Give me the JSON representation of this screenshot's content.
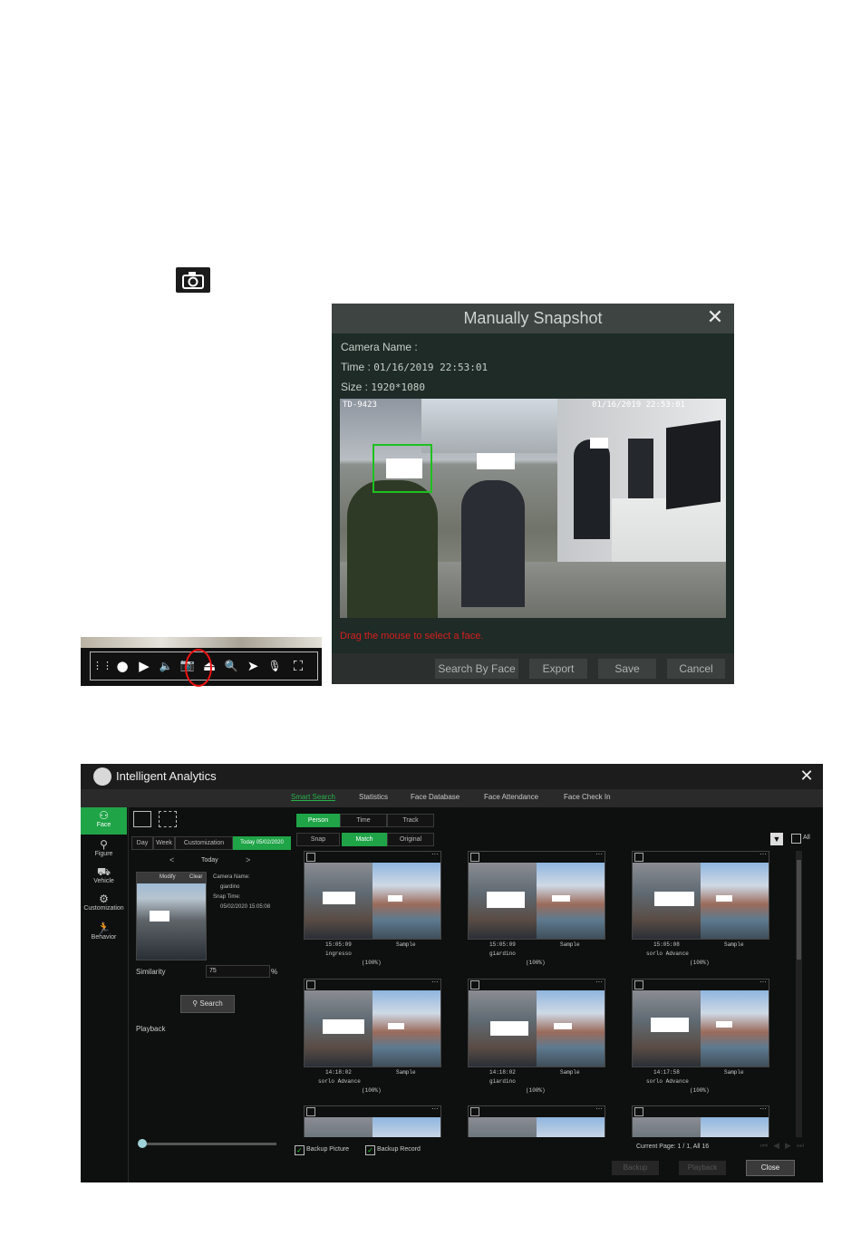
{
  "snapshot_icon": "camera-icon",
  "toolbar": {
    "icons": [
      "drag-handle-icon",
      "record-icon",
      "play-icon",
      "mute-icon",
      "snapshot-camera-icon",
      "pan-icon",
      "zoom-icon",
      "ptz-icon",
      "talk-icon",
      "face-frame-icon"
    ],
    "glyphs": [
      "⋮⋮",
      "●",
      "▶",
      "🔈",
      "📷",
      "⏏",
      "🔍",
      "➤",
      "🎙",
      "⛶"
    ]
  },
  "snapshot_dialog": {
    "title": "Manually Snapshot",
    "camera_name_label": "Camera Name :",
    "time_label": "Time :",
    "time_value": "01/16/2019 22:53:01",
    "size_label": "Size :",
    "size_value": "1920*1080",
    "osd_left": "TD-9423",
    "osd_right": "01/16/2019 22:53:01",
    "hint": "Drag the mouse to select a face.",
    "buttons": [
      "Search By Face",
      "Export",
      "Save",
      "Cancel"
    ]
  },
  "analytics": {
    "title": "Intelligent Analytics",
    "tabs": [
      "Smart Search",
      "Statistics",
      "Face Database",
      "Face Attendance",
      "Face Check In"
    ],
    "active_tab": "Smart Search",
    "sidebar": [
      {
        "label": "Face",
        "icon": "face-icon"
      },
      {
        "label": "Figure",
        "icon": "figure-icon"
      },
      {
        "label": "Vehicle",
        "icon": "vehicle-icon"
      },
      {
        "label": "Customization",
        "icon": "customization-icon"
      },
      {
        "label": "Behavior",
        "icon": "behavior-icon"
      }
    ],
    "period_tabs": [
      "Day",
      "Week",
      "Customization",
      "Today 05/02/2020"
    ],
    "date_nav": "Today",
    "face_panel": {
      "modify": "Modify",
      "clear": "Clear",
      "camera_name_label": "Camera Name:",
      "camera_name": "giardino",
      "snap_time_label": "Snap Time:",
      "snap_time": "05/02/2020 15:05:08"
    },
    "similarity_label": "Similarity",
    "similarity_value": "75",
    "similarity_unit": "%",
    "search_button": "Search",
    "playback_label": "Playback",
    "mode_tabs": [
      "Person",
      "Time",
      "Track"
    ],
    "view_tabs": [
      "Snap",
      "Match",
      "Original"
    ],
    "all_label": "All",
    "results": [
      {
        "time": "15:05:09",
        "camera": "ingresso",
        "sample": "Sample",
        "score": "(100%)"
      },
      {
        "time": "15:05:09",
        "camera": "giardino",
        "sample": "Sample",
        "score": "(100%)"
      },
      {
        "time": "15:05:08",
        "camera": "sorlo Advance",
        "sample": "Sample",
        "score": "(100%)"
      },
      {
        "time": "14:18:02",
        "camera": "sorlo Advance",
        "sample": "Sample",
        "score": "(100%)"
      },
      {
        "time": "14:18:02",
        "camera": "giardino",
        "sample": "Sample",
        "score": "(100%)"
      },
      {
        "time": "14:17:58",
        "camera": "sorlo Advance",
        "sample": "Sample",
        "score": "(100%)"
      }
    ],
    "backup_picture": "Backup Picture",
    "backup_record": "Backup Record",
    "page_info": "Current Page: 1 / 1, All 16",
    "bottom_buttons": [
      "Backup",
      "Playback",
      "Close"
    ]
  }
}
